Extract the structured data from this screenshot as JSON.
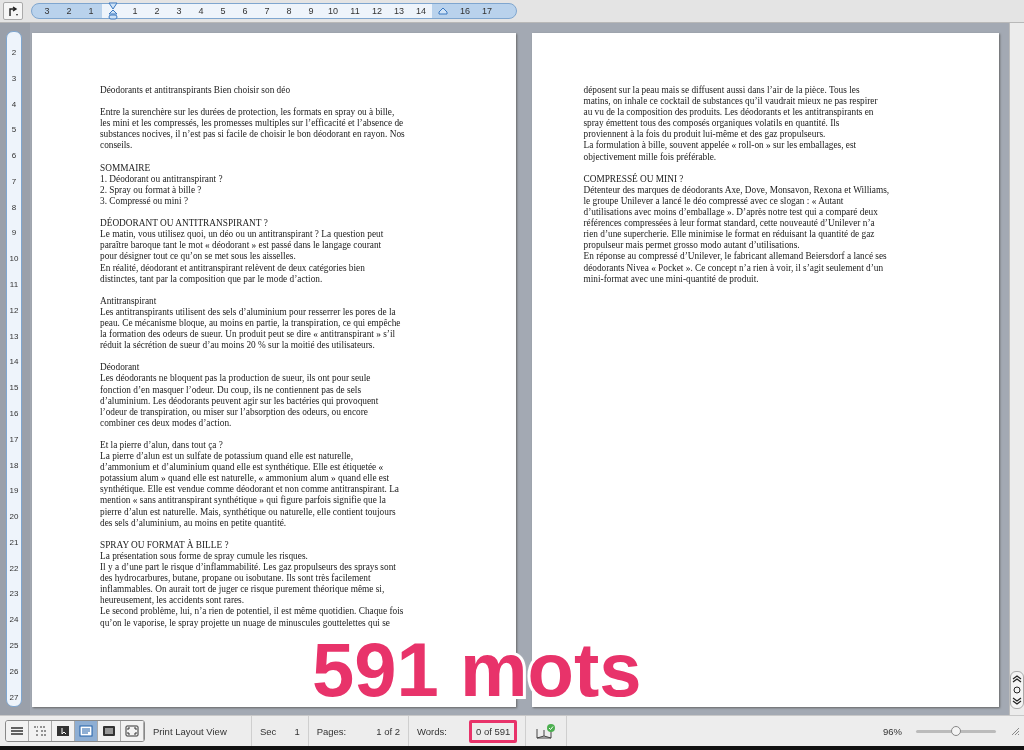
{
  "ruler": {
    "items": [
      {
        "kind": "number",
        "label": "3"
      },
      {
        "kind": "number",
        "label": "2"
      },
      {
        "kind": "number",
        "label": "1"
      },
      {
        "kind": "indent"
      },
      {
        "kind": "number",
        "label": "1"
      },
      {
        "kind": "number",
        "label": "2"
      },
      {
        "kind": "number",
        "label": "3"
      },
      {
        "kind": "number",
        "label": "4"
      },
      {
        "kind": "number",
        "label": "5"
      },
      {
        "kind": "number",
        "label": "6"
      },
      {
        "kind": "number",
        "label": "7"
      },
      {
        "kind": "number",
        "label": "8"
      },
      {
        "kind": "number",
        "label": "9"
      },
      {
        "kind": "number",
        "label": "10"
      },
      {
        "kind": "number",
        "label": "11"
      },
      {
        "kind": "number",
        "label": "12"
      },
      {
        "kind": "number",
        "label": "13"
      },
      {
        "kind": "number",
        "label": "14"
      },
      {
        "kind": "margin"
      },
      {
        "kind": "number",
        "label": "16"
      },
      {
        "kind": "number",
        "label": "17"
      }
    ]
  },
  "vertical_ruler": {
    "labels": [
      "2",
      "3",
      "4",
      "5",
      "6",
      "7",
      "8",
      "9",
      "10",
      "11",
      "12",
      "13",
      "14",
      "15",
      "16",
      "17",
      "18",
      "19",
      "20",
      "21",
      "22",
      "23",
      "24",
      "25",
      "26",
      "27"
    ]
  },
  "pages": [
    {
      "paragraphs": [
        {
          "lines": [
            "Déodorants et antitranspirants Bien choisir son déo"
          ]
        },
        {
          "lines": [
            "Entre la surenchère sur les durées de protection, les formats en spray ou à bille,",
            "les mini et les compressés, les promesses multiples sur l’efficacité et l’absence de",
            "substances nocives, il n’est pas si facile de choisir le bon déodorant en rayon. Nos",
            "conseils."
          ]
        },
        {
          "lines": [
            "SOMMAIRE",
            "1. Déodorant ou antitranspirant ?",
            "2. Spray ou format à bille ?",
            "3. Compressé ou mini ?"
          ]
        },
        {
          "lines": [
            "DÉODORANT OU ANTITRANSPIRANT ?",
            "Le matin, vous utilisez quoi, un déo ou un antitranspirant ? La question peut",
            "paraître baroque tant le mot « déodorant » est passé dans le langage courant",
            "pour désigner tout ce qu’on se met sous les aisselles.",
            "En réalité, déodorant et antitranspirant relèvent de deux catégories bien",
            "distinctes, tant par la composition que par le mode d’action."
          ]
        },
        {
          "lines": [
            "Antitranspirant",
            "Les antitranspirants utilisent des sels d’aluminium pour resserrer les pores de la",
            "peau. Ce mécanisme bloque, au moins en partie, la transpiration, ce qui empêche",
            "la formation des odeurs de sueur. Un produit peut se dire « antitranspirant » s’il",
            "réduit la sécrétion de sueur d’au moins 20 % sur la moitié des utilisateurs."
          ]
        },
        {
          "lines": [
            "Déodorant",
            "Les déodorants ne bloquent pas la production de sueur, ils ont pour seule",
            "fonction d’en masquer l’odeur. Du coup, ils ne contiennent pas de sels",
            "d’aluminium. Les déodorants peuvent agir sur les bactéries qui provoquent",
            "l’odeur de transpiration, ou miser sur l’absorption des odeurs, ou encore",
            "combiner ces deux modes d’action."
          ]
        },
        {
          "lines": [
            "Et la pierre d’alun, dans tout ça ?",
            "La pierre d’alun est un sulfate de potassium quand elle est naturelle,",
            "d’ammonium et d’aluminium quand elle est synthétique. Elle est étiquetée «",
            "potassium alum » quand elle est naturelle, « ammonium alum » quand elle est",
            "synthétique. Elle est vendue comme déodorant et non comme antitranspirant. La",
            "mention « sans antitranspirant synthétique » qui figure parfois signifie que la",
            "pierre d’alun est naturelle. Mais, synthétique ou naturelle, elle contient toujours",
            "des sels d’aluminium, au moins en petite quantité."
          ]
        },
        {
          "lines": [
            "SPRAY OU FORMAT À BILLE ?",
            "La présentation sous forme de spray cumule les risques.",
            "Il y a d’une part le risque d’inflammabilité. Les gaz propulseurs des sprays sont",
            "des hydrocarbures, butane, propane ou isobutane. Ils sont très facilement",
            "inflammables. On aurait tort de juger ce risque purement théorique même si,",
            "heureusement, les accidents sont rares.",
            "Le second problème, lui, n’a rien de potentiel, il est même quotidien. Chaque fois",
            "qu’on le vaporise, le spray projette un nuage de minuscules gouttelettes qui se"
          ]
        }
      ]
    },
    {
      "paragraphs": [
        {
          "lines": [
            "déposent sur la peau mais se diffusent aussi dans l’air de la pièce. Tous les",
            "matins, on inhale ce cocktail de substances qu’il vaudrait mieux ne pas respirer",
            "au vu de la composition des produits. Les déodorants et les antitranspirants en",
            "spray émettent tous des composés organiques volatils en quantité. Ils",
            "proviennent à la fois du produit lui-même et des gaz propulseurs.",
            "La formulation à bille, souvent appelée « roll-on » sur les emballages, est",
            "objectivement mille fois préférable."
          ]
        },
        {
          "lines": [
            "COMPRESSÉ OU MINI ?",
            "Détenteur des marques de déodorants Axe, Dove, Monsavon, Rexona et Williams,",
            "le groupe Unilever a lancé le déo compressé avec ce slogan : « Autant",
            "d’utilisations avec moins d’emballage ». D’après notre test qui a comparé deux",
            "références compressées à leur format standard, cette nouveauté d’Unilever n’a",
            "rien d’une supercherie. Elle minimise le format en réduisant la quantité de gaz",
            "propulseur mais permet grosso modo autant d’utilisations.",
            "En réponse au compressé d’Unilever, le fabricant allemand Beiersdorf a lancé ses",
            "déodorants Nivea « Pocket ». Ce concept n’a rien à voir, il s’agit seulement d’un",
            "mini-format avec une mini-quantité de produit."
          ]
        }
      ]
    }
  ],
  "status_bar": {
    "view_buttons": [
      {
        "kind": "draft",
        "selected": false
      },
      {
        "kind": "outline",
        "selected": false
      },
      {
        "kind": "publishing",
        "selected": false
      },
      {
        "kind": "print",
        "selected": true
      },
      {
        "kind": "notebook",
        "selected": false
      },
      {
        "kind": "focus",
        "selected": false
      }
    ],
    "view_label": "Print Layout View",
    "section_label": "Sec",
    "section": "1",
    "pages_label": "Pages:",
    "pages": "1 of 2",
    "words_label": "Words:",
    "words": "0 of 591",
    "zoom": "96%",
    "zoom_slider": {
      "level": 0.5
    }
  },
  "annotation": {
    "text": "591 mots"
  }
}
